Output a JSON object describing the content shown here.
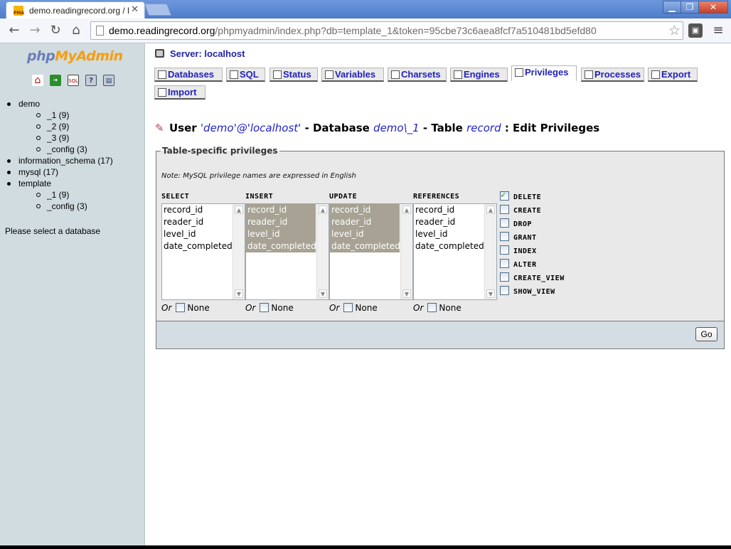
{
  "browser": {
    "tab_title": "demo.readingrecord.org / loc",
    "tab_favicon": "PMA",
    "url_host": "demo.readingrecord.org",
    "url_path": "/phpmyadmin/index.php?db=template_1&token=95cbe73c6aea8fcf7a510481bd5efd80",
    "icons": [
      "back-arrow-icon",
      "forward-arrow-icon",
      "reload-icon",
      "home-icon",
      "star-icon",
      "extension-icon",
      "wrench-menu-icon"
    ]
  },
  "sidebar": {
    "logo": {
      "php": "php",
      "my": "My",
      "admin": "Admin"
    },
    "icons": [
      "home-icon",
      "exit-icon",
      "sql-query-icon",
      "help-icon",
      "docs-icon"
    ],
    "databases": [
      {
        "name": "demo",
        "tables": [
          "_1 (9)",
          "_2 (9)",
          "_3 (9)",
          "_config (3)"
        ]
      },
      {
        "name": "information_schema (17)",
        "tables": []
      },
      {
        "name": "mysql (17)",
        "tables": []
      },
      {
        "name": "template",
        "tables": [
          "_1 (9)",
          "_config (3)"
        ]
      }
    ],
    "message": "Please select a database"
  },
  "server": {
    "label": "Server: localhost"
  },
  "tabs": [
    {
      "label": "Databases"
    },
    {
      "label": "SQL"
    },
    {
      "label": "Status"
    },
    {
      "label": "Variables"
    },
    {
      "label": "Charsets"
    },
    {
      "label": "Engines"
    },
    {
      "label": "Privileges",
      "active": true
    },
    {
      "label": "Processes"
    },
    {
      "label": "Export"
    },
    {
      "label": "Import"
    }
  ],
  "heading": {
    "user_prefix": "User",
    "user": "'demo'@'localhost'",
    "db_prefix": "- Database",
    "db": "demo\\_1",
    "table_prefix": "- Table",
    "table": "record",
    "suffix": ": Edit Privileges"
  },
  "privileges": {
    "legend": "Table-specific privileges",
    "note": "Note: MySQL privilege names are expressed in English",
    "columns": [
      {
        "label": "SELECT",
        "fields": [
          "record_id",
          "reader_id",
          "level_id",
          "date_completed"
        ],
        "selected": false
      },
      {
        "label": "INSERT",
        "fields": [
          "record_id",
          "reader_id",
          "level_id",
          "date_completed"
        ],
        "selected": true
      },
      {
        "label": "UPDATE",
        "fields": [
          "record_id",
          "reader_id",
          "level_id",
          "date_completed"
        ],
        "selected": true
      },
      {
        "label": "REFERENCES",
        "fields": [
          "record_id",
          "reader_id",
          "level_id",
          "date_completed"
        ],
        "selected": false
      }
    ],
    "or_label": "Or",
    "none_label": "None",
    "checkboxes": [
      {
        "label": "DELETE",
        "checked": true
      },
      {
        "label": "CREATE",
        "checked": false
      },
      {
        "label": "DROP",
        "checked": false
      },
      {
        "label": "GRANT",
        "checked": false
      },
      {
        "label": "INDEX",
        "checked": false
      },
      {
        "label": "ALTER",
        "checked": false
      },
      {
        "label": "CREATE_VIEW",
        "checked": false
      },
      {
        "label": "SHOW_VIEW",
        "checked": false
      }
    ],
    "go_label": "Go"
  }
}
